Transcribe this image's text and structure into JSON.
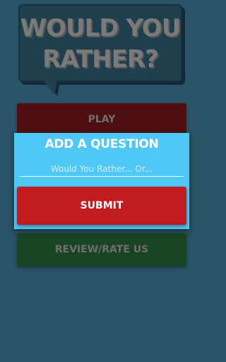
{
  "header": {
    "title_line1": "WOULD YOU",
    "title_line2": "RATHER?"
  },
  "menu": {
    "play_label": "PLAY",
    "review_label": "REVIEW/RATE US"
  },
  "dialog": {
    "title": "ADD A QUESTION",
    "input_placeholder": "Would You Rather... Or...",
    "input_value": "",
    "submit_label": "SUBMIT"
  },
  "colors": {
    "background": "#2b5366",
    "bubble": "#1f3f4f",
    "dialog": "#4fc8f5",
    "submit": "#c31c20",
    "play_dimmed": "#4f0e10",
    "review_dimmed": "#184422"
  }
}
